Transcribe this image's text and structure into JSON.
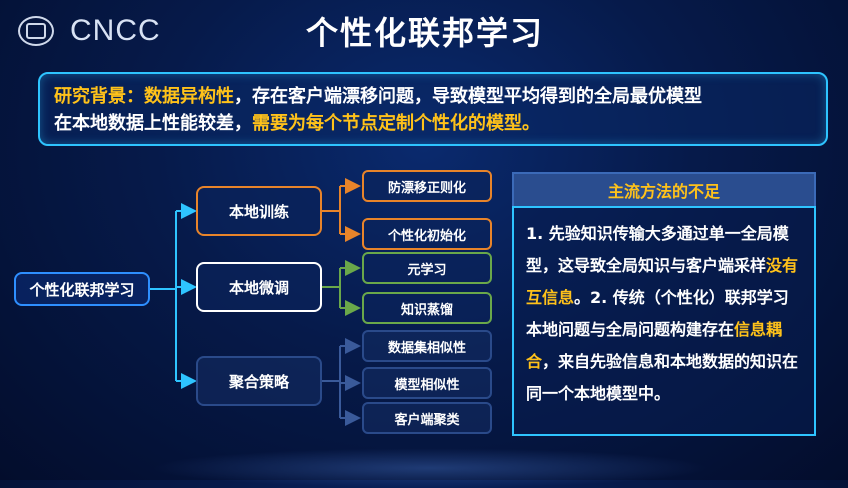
{
  "header": {
    "title": "个性化联邦学习",
    "logo_text": "CNCC",
    "seal_icon": "organization-seal-icon"
  },
  "background": {
    "label": "研究背景：",
    "keyword": "数据异构性",
    "text1": "，存在客户端漂移问题，导致模型平均得到的全局最优模型",
    "text2": "在本地数据上性能较差，",
    "emphasis": "需要为每个节点定制个性化的模型。"
  },
  "tree": {
    "root": "个性化联邦学习",
    "branches": [
      {
        "label": "本地训练",
        "children": [
          "防漂移正则化",
          "个性化初始化"
        ]
      },
      {
        "label": "本地微调",
        "children": [
          "元学习",
          "知识蒸馏"
        ]
      },
      {
        "label": "聚合策略",
        "children": [
          "数据集相似性",
          "模型相似性",
          "客户端聚类"
        ]
      }
    ]
  },
  "panel": {
    "title": "主流方法的不足",
    "p1": "1. 先验知识传输大多通过单一全局模型，这导致全局知识与客户端采样",
    "p1_hl": "没有互信息",
    "p2": "。2. 传统（个性化）联邦学习本地问题与全局问题构建存在",
    "p2_hl": "信息耦合",
    "p3": "，来自先验信息和本地数据的知识在同一个本地模型中。"
  },
  "colors": {
    "accent_yellow": "#ffc21a",
    "border_cyan": "#2ec4ff",
    "orange": "#e8842a",
    "green": "#6aa84a"
  }
}
